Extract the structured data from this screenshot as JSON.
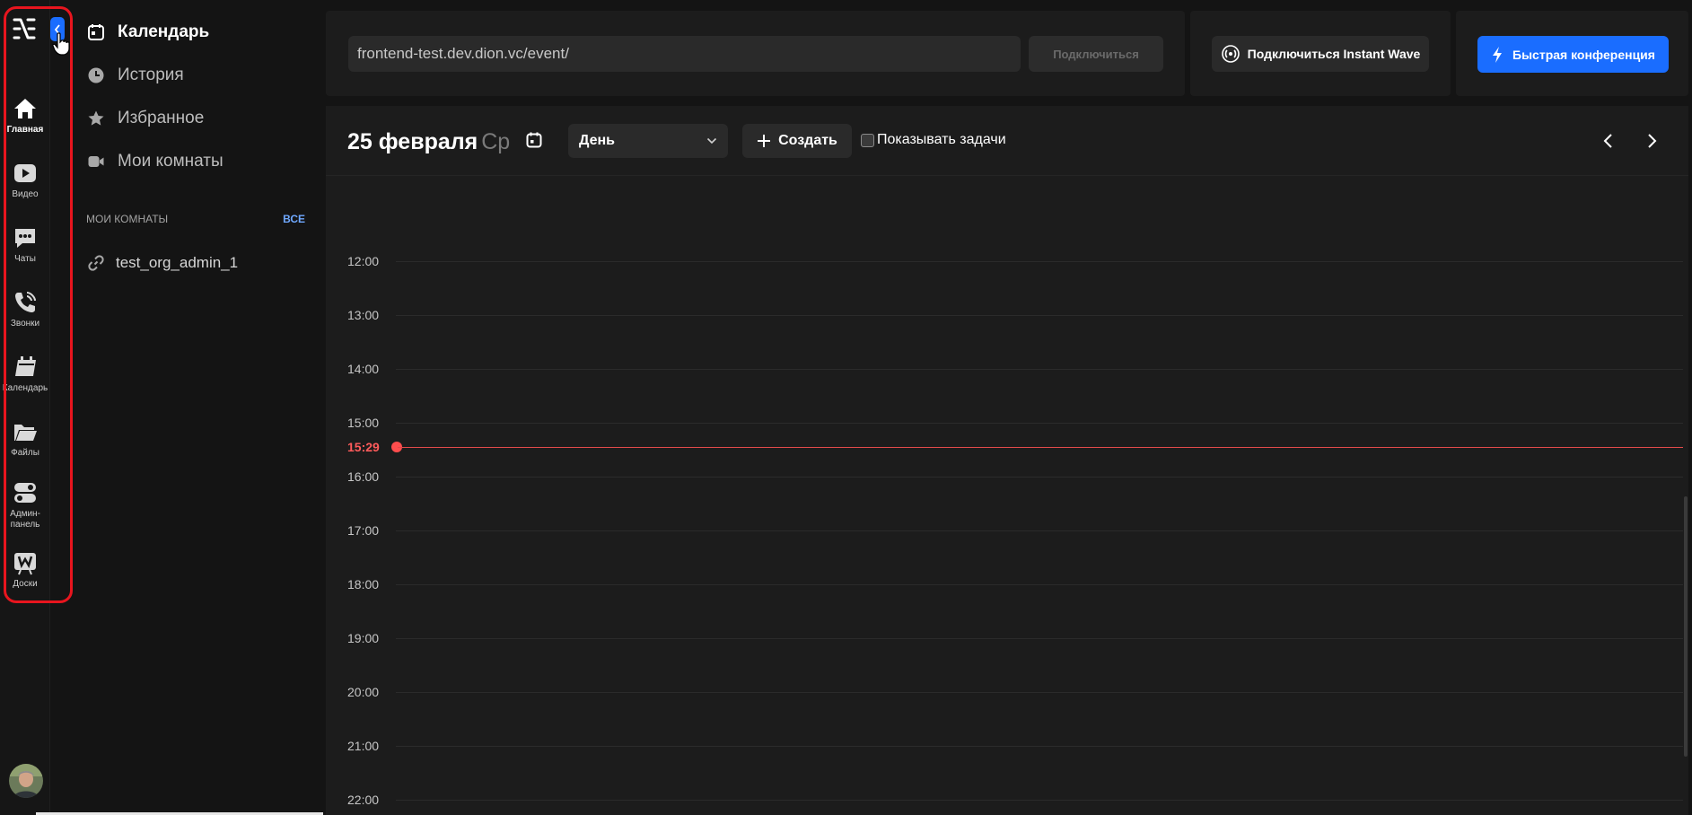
{
  "rail": {
    "collapse_icon": "chevron-left-icon",
    "items": [
      {
        "label": "Главная",
        "icon": "home-icon",
        "active": true
      },
      {
        "label": "Видео",
        "icon": "video-icon"
      },
      {
        "label": "Чаты",
        "icon": "chat-icon"
      },
      {
        "label": "Звонки",
        "icon": "phone-icon"
      },
      {
        "label": "Календарь",
        "icon": "calendar-icon"
      },
      {
        "label": "Файлы",
        "icon": "folder-icon"
      },
      {
        "label": "Админ-\nпанель",
        "icon": "toggle-icon"
      },
      {
        "label": "Доски",
        "icon": "board-icon"
      }
    ],
    "highlight_color": "#e8151e"
  },
  "sidebar": {
    "items": [
      {
        "label": "Календарь",
        "icon": "calendar-icon",
        "active": true
      },
      {
        "label": "История",
        "icon": "clock-icon"
      },
      {
        "label": "Избранное",
        "icon": "star-icon"
      },
      {
        "label": "Мои комнаты",
        "icon": "camera-icon"
      }
    ],
    "section_title": "МОИ КОМНАТЫ",
    "section_all": "ВСЕ",
    "rooms": [
      {
        "label": "test_org_admin_1",
        "icon": "link-icon"
      }
    ]
  },
  "topbar": {
    "url_value": "frontend-test.dev.dion.vc/event/",
    "connect_label": "Подключиться",
    "instant_wave_label": "Подключиться Instant Wave",
    "quick_conf_label": "Быстрая конференция",
    "accent": "#1a6dff"
  },
  "calendar": {
    "date": "25 февраля",
    "weekday": "Ср",
    "view": "День",
    "create_label": "Создать",
    "show_tasks_label": "Показывать задачи",
    "show_tasks_checked": false,
    "hours": [
      "12:00",
      "13:00",
      "14:00",
      "15:00",
      "16:00",
      "17:00",
      "18:00",
      "19:00",
      "20:00",
      "21:00",
      "22:00"
    ],
    "now_label": "15:29",
    "now_color": "#e24a4a"
  }
}
